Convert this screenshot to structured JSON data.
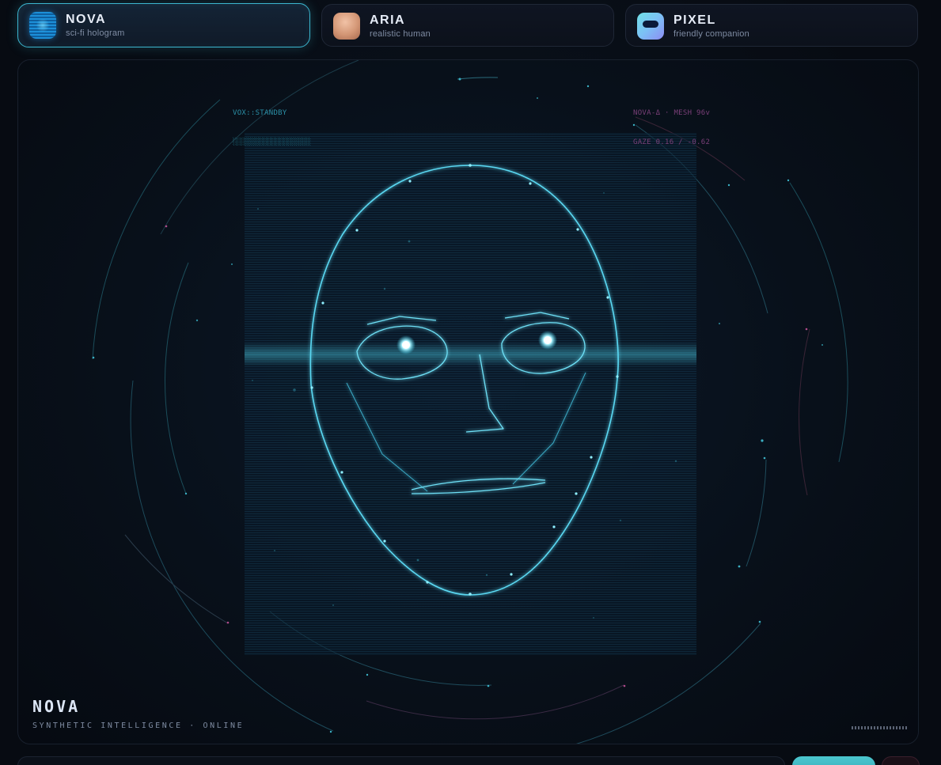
{
  "tabs": [
    {
      "label": "NOVA",
      "subtitle": "sci-fi hologram",
      "thumb_icon": "hologram-face-icon",
      "active": true
    },
    {
      "label": "ARIA",
      "subtitle": "realistic human",
      "thumb_icon": "human-face-icon",
      "active": false
    },
    {
      "label": "PIXEL",
      "subtitle": "friendly companion",
      "thumb_icon": "robot-visor-icon",
      "active": false
    }
  ],
  "hud": {
    "vox": "VOX::STANDBY",
    "level_bar": "░░░░░░░░░░░░░░░░░░░░",
    "mesh": "NOVA-Δ · MESH 96v",
    "gaze": "GAZE 0.16 / -0.62"
  },
  "character": {
    "name": "NOVA",
    "status": "SYNTHETIC INTELLIGENCE · ONLINE"
  },
  "colors": {
    "accent": "#3bb6cf",
    "hologram": "#4fd6f0",
    "hud_magenta": "#7a3f78",
    "background": "#070b12"
  }
}
